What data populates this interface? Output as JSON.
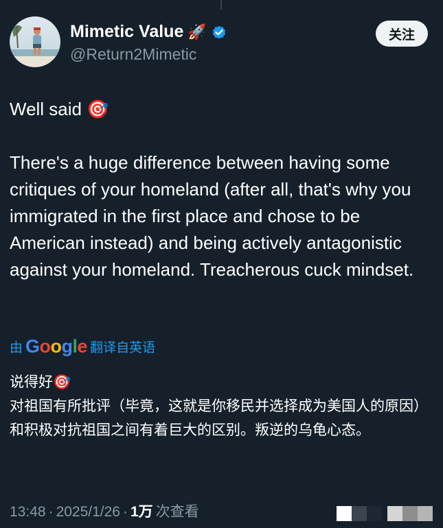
{
  "author": {
    "display_name": "Mimetic Value",
    "name_emoji": "🚀",
    "handle": "@Return2Mimetic",
    "verified": true,
    "avatar_icon": "avatar-man-on-beach"
  },
  "follow_button": {
    "label": "关注"
  },
  "tweet": {
    "text": "Well said 🎯\n\nThere's a huge difference between having some critiques of your homeland (after all, that's why you immigrated in the first place and chose to be American instead) and being actively antagonistic against your homeland. Treacherous cuck mindset."
  },
  "translation": {
    "prefix": "由",
    "provider": "Google",
    "suffix": "翻译自英语",
    "text": "说得好🎯\n对祖国有所批评（毕竟，这就是你移民并选择成为美国人的原因）和积极对抗祖国之间有着巨大的区别。叛逆的乌龟心态。"
  },
  "meta": {
    "time": "13:48",
    "separator": "·",
    "date": "2025/1/26",
    "views_count": "1万",
    "views_label": "次查看"
  },
  "colors": {
    "background": "#15202b",
    "accent": "#1d9bf0",
    "secondary_text": "#8b98a5"
  }
}
